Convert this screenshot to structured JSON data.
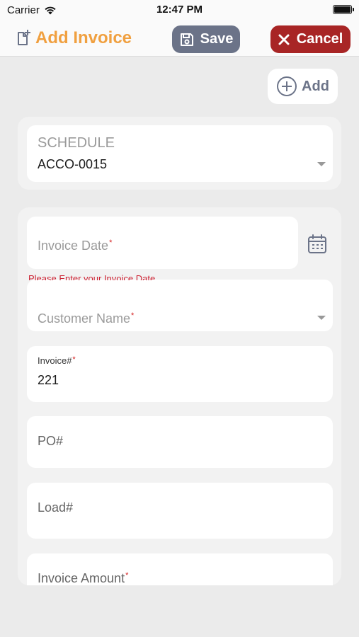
{
  "status_bar": {
    "carrier": "Carrier",
    "time": "12:47 PM"
  },
  "header": {
    "title": "Add Invoice",
    "save_label": "Save",
    "cancel_label": "Cancel"
  },
  "add_label": "Add",
  "schedule": {
    "label": "SCHEDULE",
    "value": "ACCO-0015"
  },
  "form": {
    "invoice_date": {
      "placeholder": "Invoice Date",
      "error": "Please Enter your Invoice Date"
    },
    "customer_name": {
      "placeholder": "Customer Name"
    },
    "invoice_no": {
      "label": "Invoice#",
      "value": "221"
    },
    "po": {
      "placeholder": "PO#"
    },
    "load": {
      "placeholder": "Load#"
    },
    "invoice_amount": {
      "placeholder": "Invoice Amount"
    },
    "required_mark": "*"
  },
  "colors": {
    "accent": "#f0a040",
    "save": "#6b7388",
    "cancel": "#a82525",
    "error": "#cc2233"
  }
}
